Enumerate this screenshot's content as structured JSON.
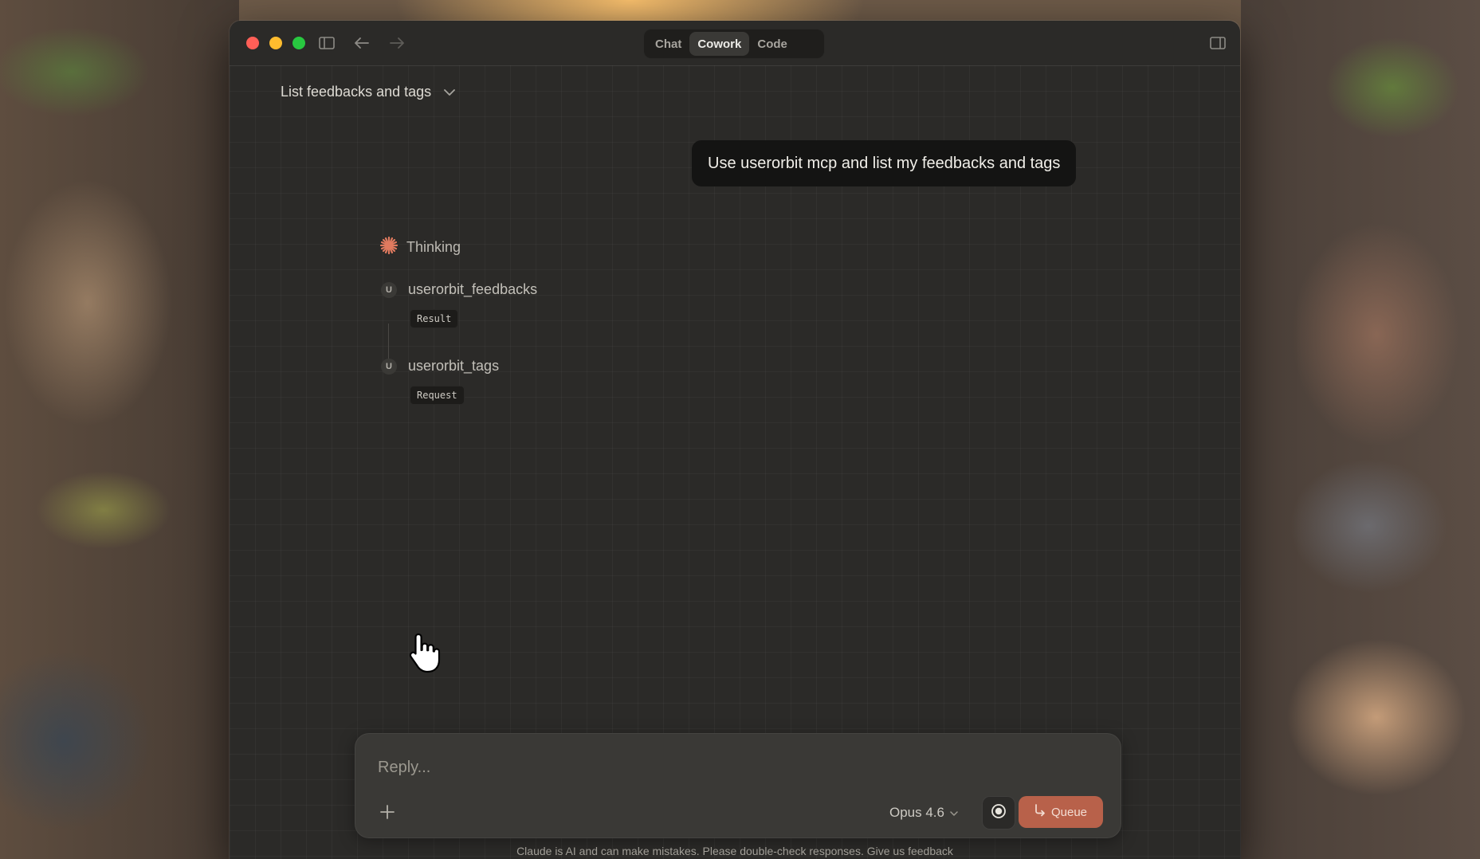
{
  "tabs": [
    {
      "label": "Chat",
      "active": false
    },
    {
      "label": "Cowork",
      "active": true
    },
    {
      "label": "Code",
      "active": false
    }
  ],
  "thread": {
    "title": "List feedbacks and tags"
  },
  "messages": {
    "user": "Use userorbit mcp and list my feedbacks and tags"
  },
  "activity": {
    "thinking_label": "Thinking",
    "tools": [
      {
        "badge": "U",
        "name": "userorbit_feedbacks",
        "status": "Result"
      },
      {
        "badge": "U",
        "name": "userorbit_tags",
        "status": "Request"
      }
    ]
  },
  "composer": {
    "placeholder": "Reply...",
    "model": "Opus 4.6",
    "queue_label": "Queue"
  },
  "footer": {
    "disclaimer": "Claude is AI and can make mistakes. Please double-check responses. Give us feedback"
  },
  "colors": {
    "accent": "#b8614a",
    "spark": "#e07a5f"
  }
}
